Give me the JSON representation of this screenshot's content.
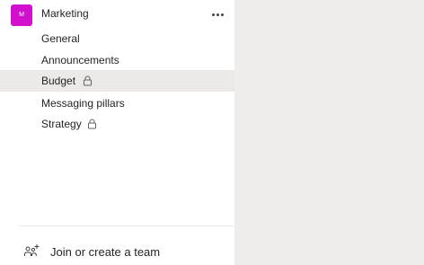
{
  "team": {
    "avatar_initial": "M",
    "avatar_color": "#d10fcc",
    "name": "Marketing",
    "more_icon": "more-horizontal-icon"
  },
  "channels": [
    {
      "label": "General",
      "private": false,
      "selected": false
    },
    {
      "label": "Announcements",
      "private": false,
      "selected": false
    },
    {
      "label": "Budget",
      "private": true,
      "selected": true
    },
    {
      "label": "Messaging pillars",
      "private": false,
      "selected": false
    },
    {
      "label": "Strategy",
      "private": true,
      "selected": false
    }
  ],
  "footer": {
    "join_icon": "people-add-icon",
    "join_label": "Join or create a team"
  }
}
